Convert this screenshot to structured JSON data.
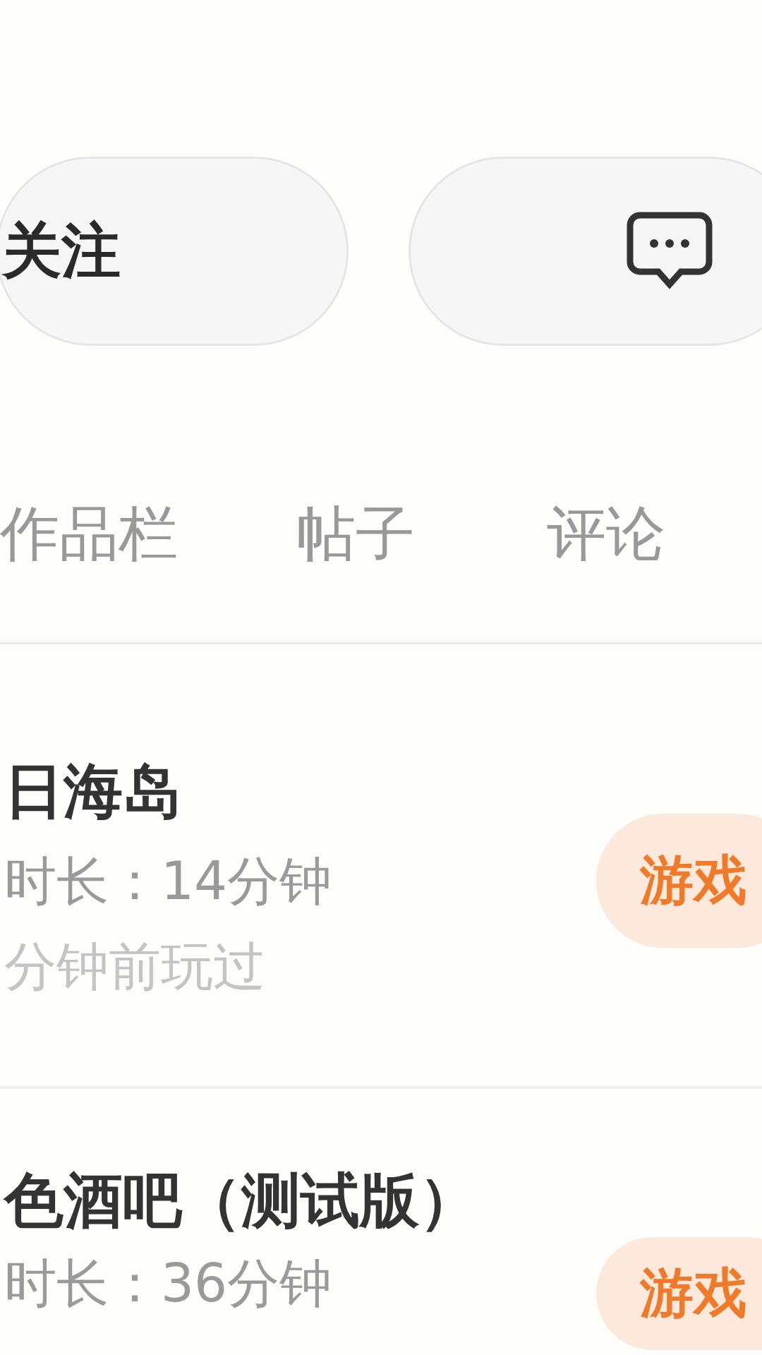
{
  "actions": [
    {
      "kind": "follow",
      "label": "关注"
    },
    {
      "kind": "comment"
    }
  ],
  "tabs": [
    {
      "label": "作品栏",
      "selected": false
    },
    {
      "label": "帖子",
      "selected": false
    },
    {
      "label": "评论",
      "selected": false
    }
  ],
  "games": [
    {
      "title": "日海岛",
      "duration": "时长：14分钟",
      "last_played": "分钟前玩过",
      "tag": "游戏"
    },
    {
      "title": "色酒吧（测试版）",
      "duration": "时长：36分钟",
      "tag": "游戏"
    }
  ]
}
